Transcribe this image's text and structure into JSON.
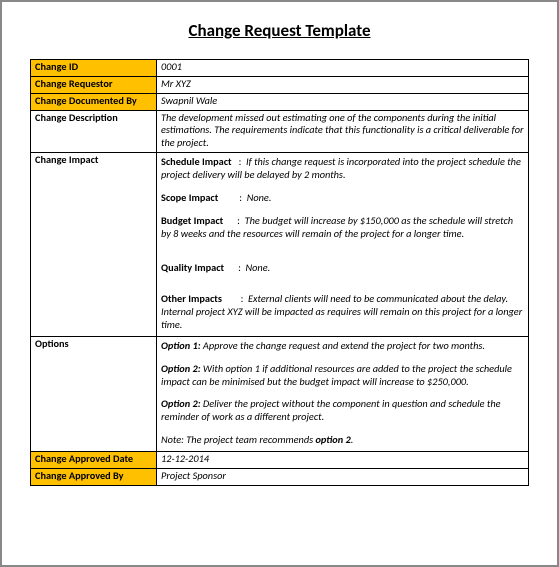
{
  "title": "Change Request Template",
  "labels": {
    "change_id": "Change ID",
    "change_requestor": "Change Requestor",
    "change_documented_by": "Change Documented By",
    "change_description": "Change Description",
    "change_impact": "Change Impact",
    "options": "Options",
    "change_approved_date": "Change Approved Date",
    "change_approved_by": "Change Approved By"
  },
  "values": {
    "change_id": "0001",
    "change_requestor": "Mr XYZ",
    "change_documented_by": "Swapnil Wale",
    "change_description": "The development missed out estimating one of the components during the initial estimations. The requirements indicate that this functionality is a critical deliverable for the project.",
    "change_approved_date": "12-12-2014",
    "change_approved_by": "Project Sponsor"
  },
  "impact": {
    "schedule": {
      "label": "Schedule Impact",
      "text": "If this change request is incorporated into the project schedule the project delivery will be delayed by 2 months."
    },
    "scope": {
      "label": "Scope Impact",
      "text": "None."
    },
    "budget": {
      "label": "Budget Impact",
      "text": "The budget will increase by $150,000 as the schedule will stretch by 8 weeks and the resources will remain of the project for a longer time."
    },
    "quality": {
      "label": "Quality Impact",
      "text": "None."
    },
    "other": {
      "label": "Other Impacts",
      "text": "External clients will need to be communicated about the delay. Internal project XYZ will be impacted as requires will remain on this project for a longer time."
    }
  },
  "options": {
    "opt1": {
      "label": "Option 1:",
      "text": " Approve the change request and extend the project for two months."
    },
    "opt2": {
      "label": "Option 2:",
      "text": " With option 1 if additional resources are added to the project the schedule impact can be minimised but the budget impact will increase to $250,000."
    },
    "opt3": {
      "label": "Option 2:",
      "text": " Deliver the project without the component in question and schedule the reminder of work as a different project."
    },
    "note_prefix": "Note: The project team recommends ",
    "note_bold": "option 2",
    "note_suffix": "."
  }
}
